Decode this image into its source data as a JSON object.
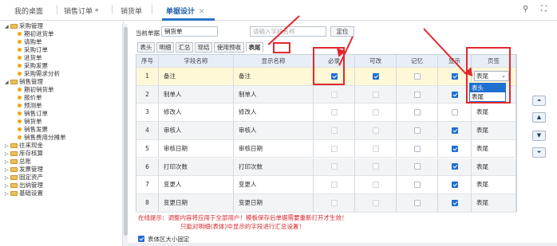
{
  "top_tabs": [
    "我的桌面",
    "销售订单 *",
    "销货单",
    "单据设计"
  ],
  "top_icons": [
    "search-icon",
    "fullscreen-icon"
  ],
  "sidebar": {
    "groups": [
      {
        "label": "采购管理",
        "expanded": true,
        "items": [
          "期初进货单",
          "请购单",
          "采购订单",
          "进货单",
          "采购发票",
          "采购需求分析"
        ]
      },
      {
        "label": "销售管理",
        "expanded": true,
        "items": [
          "期初销货单",
          "报价单",
          "预测单",
          "销售订单",
          "销货单",
          "销售发票",
          "销售费用分摊单"
        ]
      },
      {
        "label": "往来现金",
        "expanded": false,
        "items": []
      },
      {
        "label": "库存核算",
        "expanded": false,
        "items": []
      },
      {
        "label": "总账",
        "expanded": false,
        "items": []
      },
      {
        "label": "发票管理",
        "expanded": false,
        "items": []
      },
      {
        "label": "固定资产",
        "expanded": false,
        "items": []
      },
      {
        "label": "出纳管理",
        "expanded": false,
        "items": []
      },
      {
        "label": "基础设置",
        "expanded": false,
        "items": []
      }
    ]
  },
  "toolbar": {
    "bill_label": "当前单据",
    "bill_value": "销货单",
    "search_placeholder": "请输入字段名称",
    "locate_button": "定位"
  },
  "subtabs": [
    "表头",
    "明细",
    "汇总",
    "现结",
    "使用预收",
    "表尾"
  ],
  "grid": {
    "columns": [
      "序号",
      "字段名称",
      "显示名称",
      "必录",
      "可改",
      "记忆",
      "显示",
      "页签"
    ],
    "rows": [
      {
        "no": "1",
        "field": "备注",
        "display": "备注",
        "required": true,
        "editable": true,
        "memory": false,
        "show": true,
        "tab": "表尾"
      },
      {
        "no": "2",
        "field": "制单人",
        "display": "制单人",
        "required": false,
        "editable": false,
        "memory": false,
        "show": true,
        "tab": "表尾"
      },
      {
        "no": "3",
        "field": "修改人",
        "display": "修改人",
        "required": false,
        "editable": false,
        "memory": false,
        "show": false,
        "tab": "表尾"
      },
      {
        "no": "4",
        "field": "审核人",
        "display": "审核人",
        "required": false,
        "editable": false,
        "memory": false,
        "show": true,
        "tab": "表尾"
      },
      {
        "no": "5",
        "field": "审核日期",
        "display": "审核日期",
        "required": false,
        "editable": false,
        "memory": false,
        "show": true,
        "tab": "表尾"
      },
      {
        "no": "6",
        "field": "打印次数",
        "display": "打印次数",
        "required": false,
        "editable": false,
        "memory": false,
        "show": true,
        "tab": "表尾"
      },
      {
        "no": "7",
        "field": "变更人",
        "display": "变更人",
        "required": false,
        "editable": false,
        "memory": false,
        "show": true,
        "tab": "表尾"
      },
      {
        "no": "8",
        "field": "变更日期",
        "display": "变更日期",
        "required": false,
        "editable": false,
        "memory": false,
        "show": true,
        "tab": "表尾"
      }
    ],
    "dropdown_options": [
      "表头",
      "表尾"
    ],
    "dropdown_highlighted": "表头"
  },
  "hint": {
    "line1": "在线提示：调整内容将应用于全部用户！模板保存后单据需要重新打开才生效！",
    "line2": "只能对明细(表体)中显示的字段进行汇总设置！"
  },
  "fix_size_label": "表体区大小固定",
  "arrow_buttons": [
    "move-top",
    "move-up",
    "move-down",
    "move-bottom"
  ],
  "colors": {
    "accent": "#1f6fd0",
    "annotation": "#e0282e",
    "hint_text": "#d7262c"
  }
}
